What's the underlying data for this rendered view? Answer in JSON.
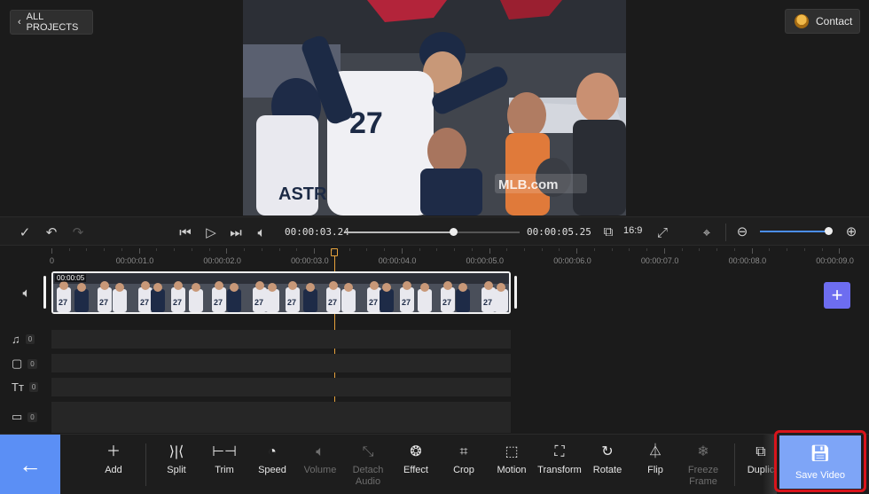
{
  "header": {
    "projects_label": "ALL PROJECTS",
    "contact_label": "Contact"
  },
  "preview": {
    "watermark": "MLB.com"
  },
  "playback": {
    "current_time": "00:00:03.24",
    "total_time": "00:00:05.25",
    "aspect_ratio": "16:9",
    "progress": 0.62,
    "zoom_level": 0.92
  },
  "timeline": {
    "ticks": [
      "0",
      "00:00:01.0",
      "00:00:02.0",
      "00:00:03.0",
      "00:00:04.0",
      "00:00:05.0",
      "00:00:06.0",
      "00:00:07.0",
      "00:00:08.0",
      "00:00:09.0"
    ],
    "clip_start_label": "00:00:05",
    "tracks": [
      {
        "name": "music",
        "icon": "music-note-icon",
        "count": "0"
      },
      {
        "name": "sticker",
        "icon": "sticker-icon",
        "count": "0"
      },
      {
        "name": "text",
        "icon": "text-icon",
        "count": "0"
      },
      {
        "name": "subtitle",
        "icon": "subtitle-icon",
        "count": "0"
      }
    ]
  },
  "toolbar": {
    "tools": [
      {
        "label": "Add",
        "icon": "plus-icon",
        "enabled": true
      },
      {
        "label": "Split",
        "icon": "split-icon",
        "enabled": true
      },
      {
        "label": "Trim",
        "icon": "trim-icon",
        "enabled": true
      },
      {
        "label": "Speed",
        "icon": "speed-icon",
        "enabled": true
      },
      {
        "label": "Volume",
        "icon": "volume-icon",
        "enabled": false
      },
      {
        "label": "Detach Audio",
        "icon": "detach-audio-icon",
        "enabled": false
      },
      {
        "label": "Effect",
        "icon": "effect-icon",
        "enabled": true
      },
      {
        "label": "Crop",
        "icon": "crop-icon",
        "enabled": true
      },
      {
        "label": "Motion",
        "icon": "motion-icon",
        "enabled": true
      },
      {
        "label": "Transform",
        "icon": "transform-icon",
        "enabled": true
      },
      {
        "label": "Rotate",
        "icon": "rotate-icon",
        "enabled": true
      },
      {
        "label": "Flip",
        "icon": "flip-icon",
        "enabled": true
      },
      {
        "label": "Freeze Frame",
        "icon": "snowflake-icon",
        "enabled": false
      },
      {
        "label": "Duplic",
        "icon": "duplicate-icon",
        "enabled": true
      }
    ],
    "save_label": "Save Video"
  },
  "colors": {
    "accent": "#5b8ff5",
    "save_button": "#7ea5f7",
    "highlight_border": "#d8141b",
    "playhead": "#e6a23c",
    "add_track": "#6d6df0"
  }
}
